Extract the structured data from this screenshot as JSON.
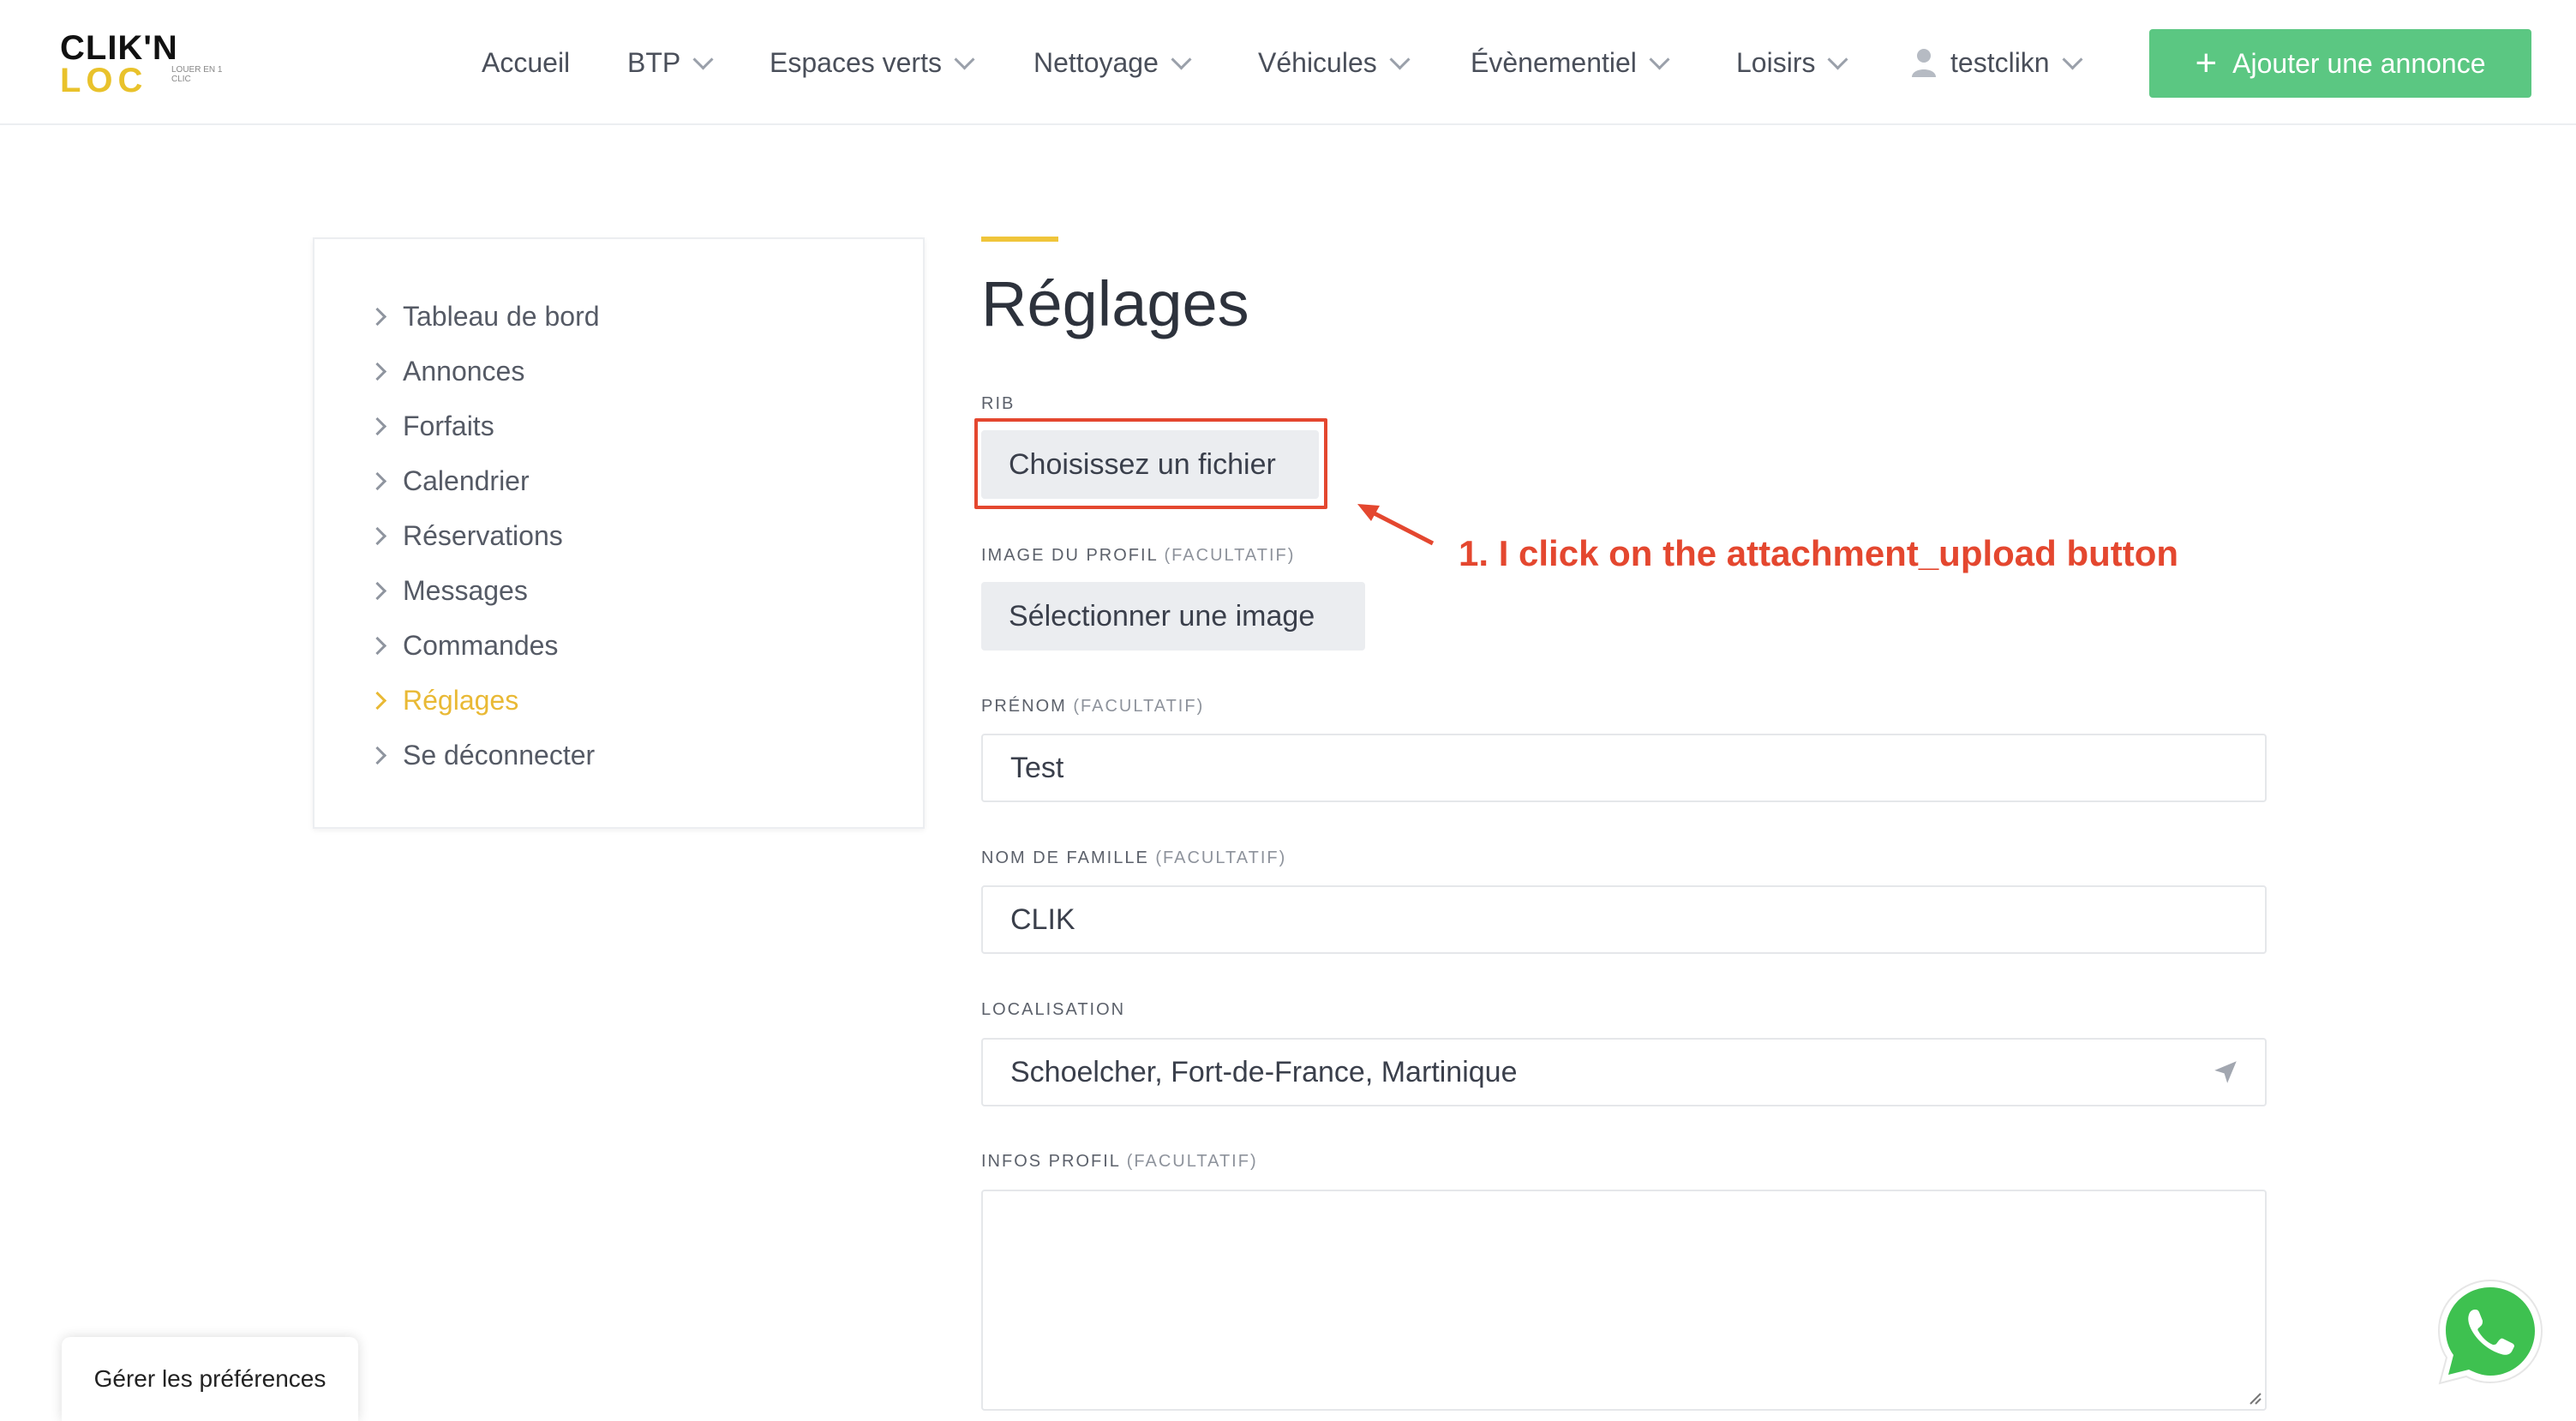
{
  "header": {
    "logo": {
      "line1": "CLIK'N",
      "line2": "LOC",
      "tagline": "LOUER EN 1 CLIC"
    },
    "nav": [
      {
        "label": "Accueil",
        "dropdown": false
      },
      {
        "label": "BTP",
        "dropdown": true
      },
      {
        "label": "Espaces verts",
        "dropdown": true
      },
      {
        "label": "Nettoyage",
        "dropdown": true
      },
      {
        "label": "Véhicules",
        "dropdown": true
      },
      {
        "label": "Évènementiel",
        "dropdown": true
      },
      {
        "label": "Loisirs",
        "dropdown": true
      }
    ],
    "user": {
      "name": "testclikn",
      "icon": "user-icon"
    },
    "add_button": {
      "label": "Ajouter une annonce",
      "icon": "plus-icon"
    }
  },
  "sidebar": {
    "items": [
      {
        "label": "Tableau de bord",
        "active": false
      },
      {
        "label": "Annonces",
        "active": false
      },
      {
        "label": "Forfaits",
        "active": false
      },
      {
        "label": "Calendrier",
        "active": false
      },
      {
        "label": "Réservations",
        "active": false
      },
      {
        "label": "Messages",
        "active": false
      },
      {
        "label": "Commandes",
        "active": false
      },
      {
        "label": "Réglages",
        "active": true
      },
      {
        "label": "Se déconnecter",
        "active": false
      }
    ]
  },
  "main": {
    "title": "Réglages",
    "rib": {
      "label": "RIB",
      "button": "Choisissez un fichier"
    },
    "profile_image": {
      "label": "IMAGE DU PROFIL",
      "optional": "(FACULTATIF)",
      "button": "Sélectionner une image"
    },
    "first_name": {
      "label": "PRÉNOM",
      "optional": "(FACULTATIF)",
      "value": "Test"
    },
    "last_name": {
      "label": "NOM DE FAMILLE",
      "optional": "(FACULTATIF)",
      "value": "CLIK"
    },
    "location": {
      "label": "LOCALISATION",
      "value": "Schoelcher, Fort-de-France, Martinique",
      "icon": "location-arrow-icon"
    },
    "profile_info": {
      "label": "INFOS PROFIL",
      "optional": "(FACULTATIF)",
      "value": ""
    }
  },
  "annotation": {
    "text": "1. I click on the attachment_upload button",
    "color": "#e4472f"
  },
  "cookie_prefs": {
    "label": "Gérer les préférences"
  },
  "whatsapp": {
    "icon": "whatsapp-icon"
  },
  "colors": {
    "accent_yellow": "#f0c53a",
    "add_button_green": "#5bc782",
    "annotation_red": "#e4472f"
  }
}
